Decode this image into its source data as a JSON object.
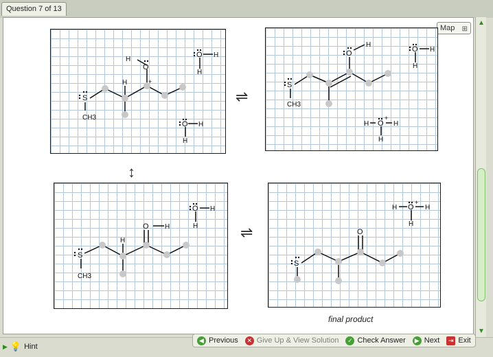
{
  "header": {
    "question_tab": "Question 7 of 13"
  },
  "map": {
    "label": "Map",
    "icon": "sitemap-icon"
  },
  "panels": {
    "p1": {
      "atoms": {
        "s": "S",
        "ch3": "CH3",
        "h_mid": "H",
        "h_oh": "H",
        "o": "O",
        "plus": "+",
        "w_o": "O",
        "w_h1": "H",
        "w_h2": "H",
        "w2_o": "O",
        "w2_h1": "H",
        "w2_h2": "H"
      }
    },
    "p2": {
      "atoms": {
        "s": "S",
        "ch3": "CH3",
        "o": "O",
        "h_oh": "H",
        "w_o": "O",
        "w_h1": "H",
        "w_h2": "H",
        "h3_o": "O",
        "h3_h1": "H",
        "h3_h2": "H",
        "h3_h3": "H",
        "plus": "+"
      }
    },
    "p3": {
      "atoms": {
        "s": "S",
        "ch3": "CH3",
        "h_mid": "H",
        "o": "O",
        "h_oh": "H",
        "w_o": "O",
        "w_h1": "H",
        "w_h2": "H"
      }
    },
    "p4": {
      "atoms": {
        "s": "S",
        "o": "O",
        "h3_o": "O",
        "h3_h1": "H",
        "h3_h2": "H",
        "h3_h3": "H",
        "plus": "+"
      },
      "caption": "final product"
    }
  },
  "arrows": {
    "equilibrium": "⇌",
    "resonance": "↕"
  },
  "footer": {
    "hint": "Hint",
    "previous": "Previous",
    "give_up": "Give Up & View Solution",
    "check": "Check Answer",
    "next": "Next",
    "exit": "Exit"
  }
}
